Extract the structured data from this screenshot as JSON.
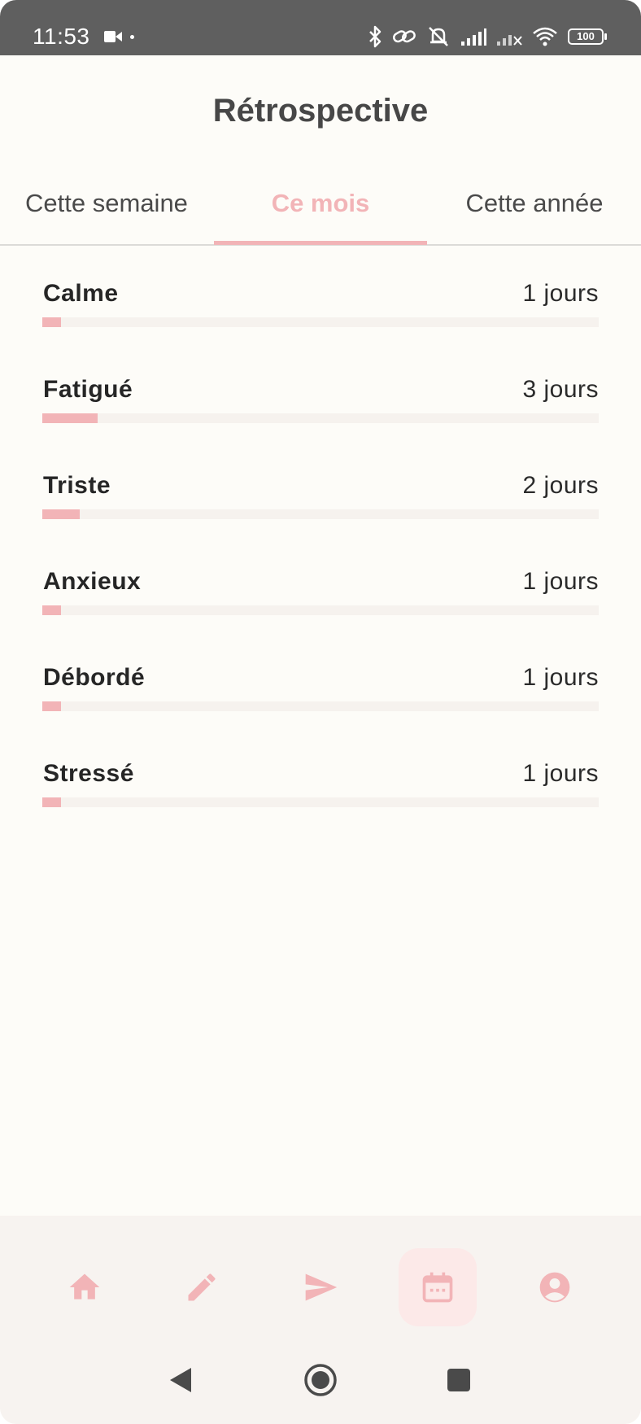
{
  "status_bar": {
    "time": "11:53",
    "battery": "100"
  },
  "header": {
    "title": "Rétrospective"
  },
  "tabs": [
    {
      "label": "Cette semaine",
      "active": false
    },
    {
      "label": "Ce mois",
      "active": true
    },
    {
      "label": "Cette année",
      "active": false
    }
  ],
  "moods": [
    {
      "name": "Calme",
      "count_label": "1 jours",
      "days": 1
    },
    {
      "name": "Fatigué",
      "count_label": "3 jours",
      "days": 3
    },
    {
      "name": "Triste",
      "count_label": "2 jours",
      "days": 2
    },
    {
      "name": "Anxieux",
      "count_label": "1 jours",
      "days": 1
    },
    {
      "name": "Débordé",
      "count_label": "1 jours",
      "days": 1
    },
    {
      "name": "Stressé",
      "count_label": "1 jours",
      "days": 1
    }
  ],
  "bar_scale_max_days": 30,
  "bottom_nav": [
    {
      "icon": "home-icon",
      "active": false
    },
    {
      "icon": "pencil-icon",
      "active": false
    },
    {
      "icon": "send-icon",
      "active": false
    },
    {
      "icon": "calendar-icon",
      "active": true
    },
    {
      "icon": "account-circle-icon",
      "active": false
    }
  ],
  "colors": {
    "accent": "#f2b4b7",
    "background": "#fdfcf8",
    "status_bar": "#5f5f5f",
    "track": "#f6f2ee",
    "active_nav_bg": "#fce9e8"
  }
}
